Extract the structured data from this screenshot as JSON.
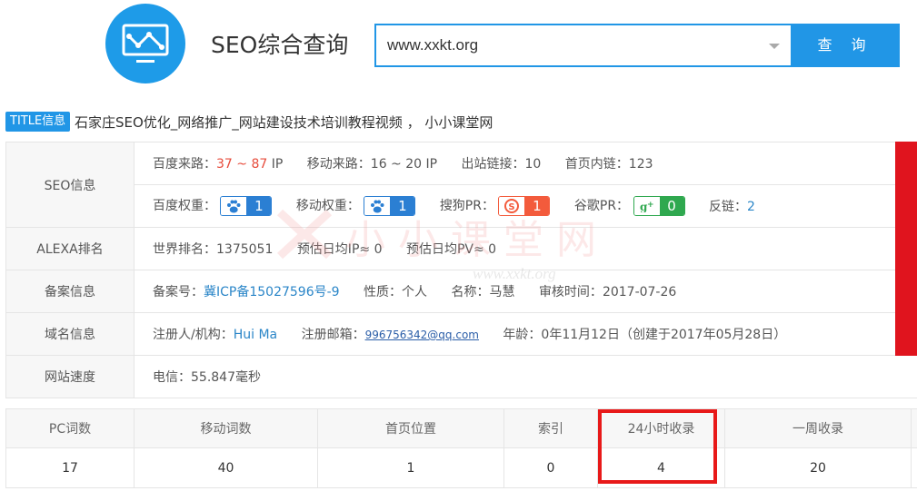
{
  "header": {
    "brand_title": "SEO综合查询",
    "search_value": "www.xxkt.org",
    "search_button": "查 询"
  },
  "title_row": {
    "badge": "TITLE信息",
    "text": "石家庄SEO优化_网络推广_网站建设技术培训教程视频 ， 小小课堂网"
  },
  "seo_info": {
    "label": "SEO信息",
    "row1": {
      "baidu_source_label": "百度来路：",
      "baidu_source_min": "37",
      "baidu_source_sep": " ~ ",
      "baidu_source_max": "87",
      "baidu_source_unit": " IP",
      "mobile_source_label": "移动来路：",
      "mobile_source_value": "16 ~ 20 IP",
      "outbound_label": "出站链接：",
      "outbound_value": "10",
      "home_internal_label": "首页内链：",
      "home_internal_value": "123"
    },
    "row2": {
      "baidu_weight_label": "百度权重：",
      "baidu_weight_value": "1",
      "mobile_weight_label": "移动权重：",
      "mobile_weight_value": "1",
      "sogou_pr_label": "搜狗PR：",
      "sogou_pr_value": "1",
      "google_pr_label": "谷歌PR：",
      "google_pr_value": "0",
      "backlinks_label": "反链：",
      "backlinks_value": "2"
    }
  },
  "alexa": {
    "label": "ALEXA排名",
    "world_rank_label": "世界排名：",
    "world_rank_value": "1375051",
    "daily_ip_label": "预估日均IP≈",
    "daily_ip_value": "0",
    "daily_pv_label": "预估日均PV≈",
    "daily_pv_value": "0"
  },
  "icp": {
    "label": "备案信息",
    "number_label": "备案号：",
    "number_value": "冀ICP备15027596号-9",
    "nature_label": "性质：",
    "nature_value": "个人",
    "name_label": "名称：",
    "name_value": "马慧",
    "review_label": "审核时间：",
    "review_value": "2017-07-26"
  },
  "domain": {
    "label": "域名信息",
    "registrant_label": "注册人/机构：",
    "registrant_value": "Hui Ma",
    "email_label": "注册邮箱：",
    "email_value": "996756342@qq.com",
    "age_label": "年龄：",
    "age_value": "0年11月12日（创建于2017年05月28日）"
  },
  "speed": {
    "label": "网站速度",
    "value": "电信：55.847毫秒"
  },
  "watermark": {
    "cn": "小小课堂网",
    "url": "www.xxkt.org"
  },
  "stats": {
    "headers": [
      "PC词数",
      "移动词数",
      "首页位置",
      "索引",
      "24小时收录",
      "一周收录"
    ],
    "values": [
      "17",
      "40",
      "1",
      "0",
      "4",
      "20"
    ]
  },
  "colors": {
    "accent": "#2196e6",
    "highlight": "#e81919",
    "banner": "#e0141e"
  }
}
